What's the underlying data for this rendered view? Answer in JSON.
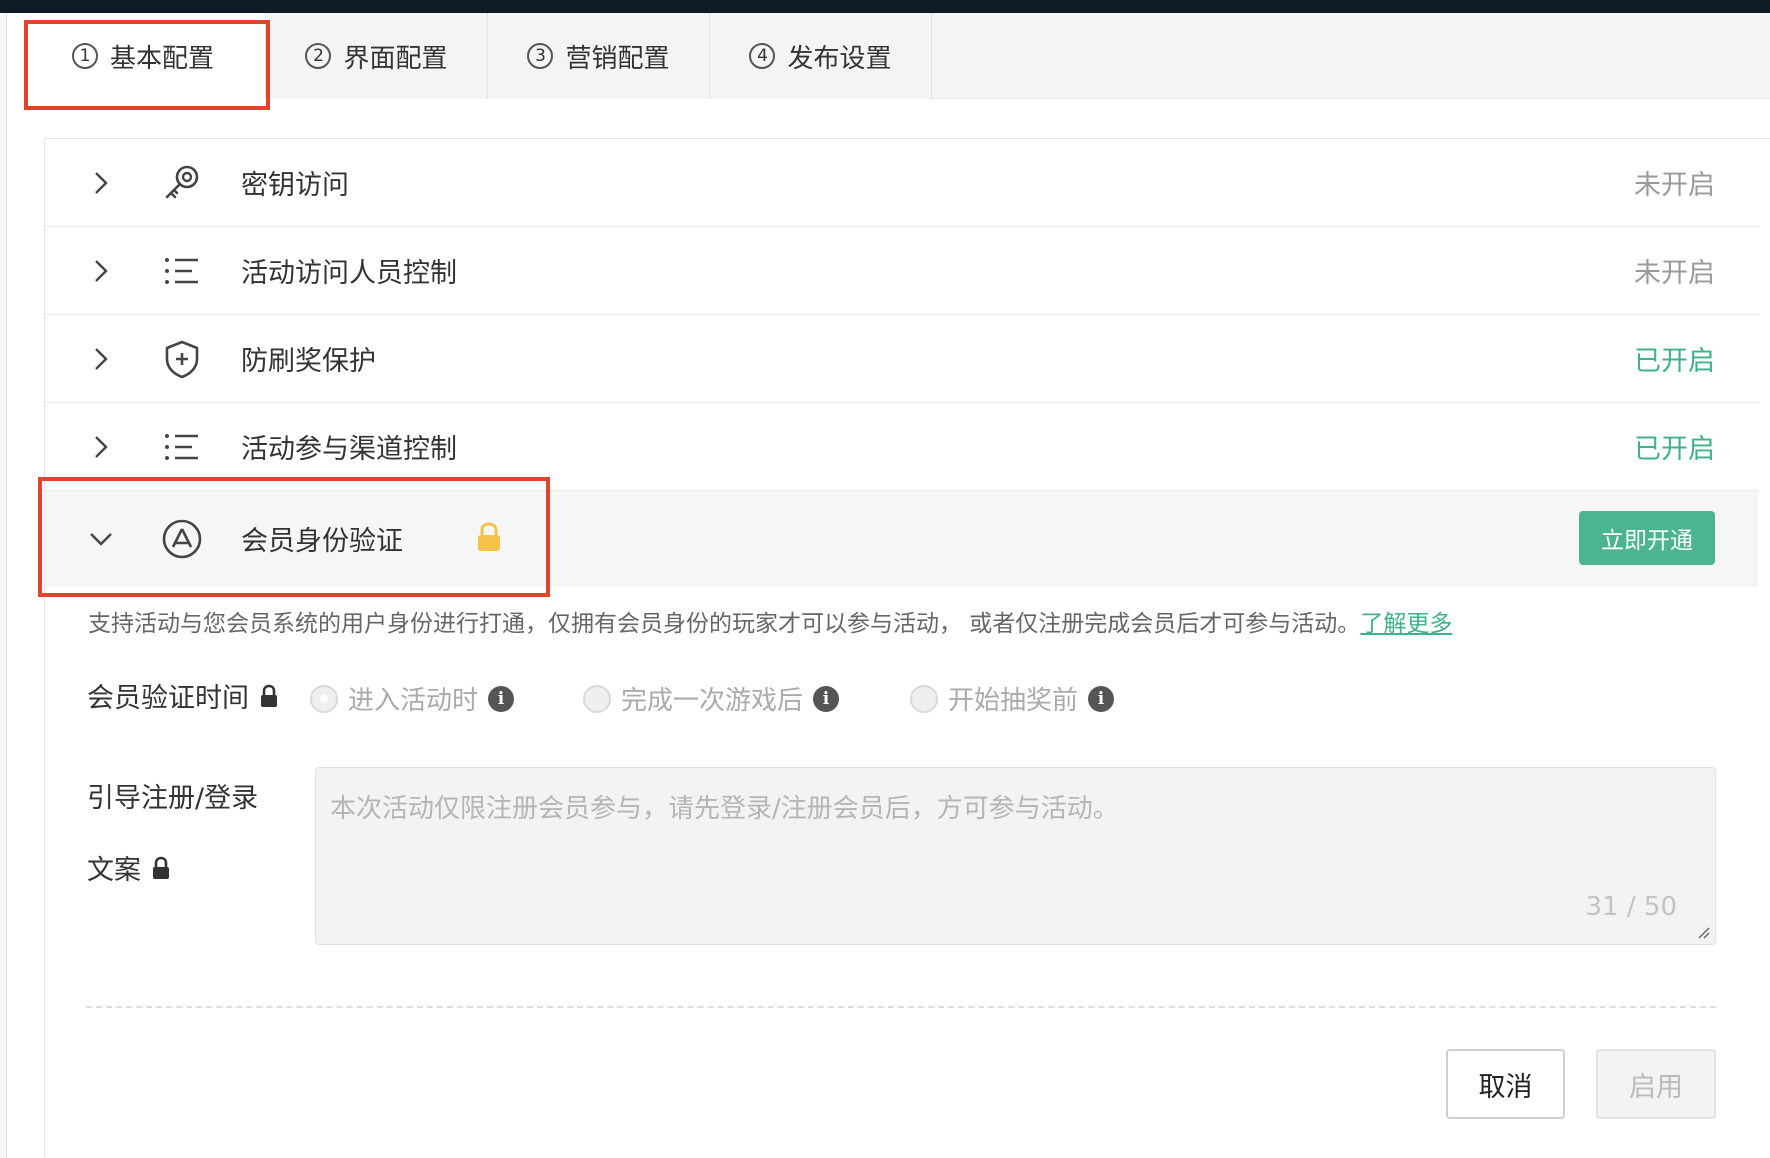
{
  "tabs": [
    {
      "num": "1",
      "label": "基本配置"
    },
    {
      "num": "2",
      "label": "界面配置"
    },
    {
      "num": "3",
      "label": "营销配置"
    },
    {
      "num": "4",
      "label": "发布设置"
    }
  ],
  "rows": [
    {
      "label": "密钥访问",
      "status": "未开启",
      "icon": "key-icon"
    },
    {
      "label": "活动访问人员控制",
      "status": "未开启",
      "icon": "list-icon"
    },
    {
      "label": "防刷奖保护",
      "status": "已开启",
      "icon": "shield-icon"
    },
    {
      "label": "活动参与渠道控制",
      "status": "已开启",
      "icon": "list-icon"
    },
    {
      "label": "会员身份验证",
      "icon": "user-circle-icon",
      "action": "立即开通"
    }
  ],
  "member": {
    "description": "支持活动与您会员系统的用户身份进行打通，仅拥有会员身份的玩家才可以参与活动， 或者仅注册完成会员后才可参与活动。",
    "learn_more": "了解更多",
    "time_label": "会员验证时间",
    "time_options": [
      "进入活动时",
      "完成一次游戏后",
      "开始抽奖前"
    ],
    "guide_label_1": "引导注册/登录",
    "guide_label_2": "文案",
    "guide_placeholder": "本次活动仅限注册会员参与，请先登录/注册会员后，方可参与活动。",
    "char_count": "31 / 50"
  },
  "buttons": {
    "cancel": "取消",
    "enable": "启用"
  },
  "colors": {
    "accent": "#4cb48e",
    "highlight": "#e2432f",
    "enabled_status": "#3fb28a"
  }
}
